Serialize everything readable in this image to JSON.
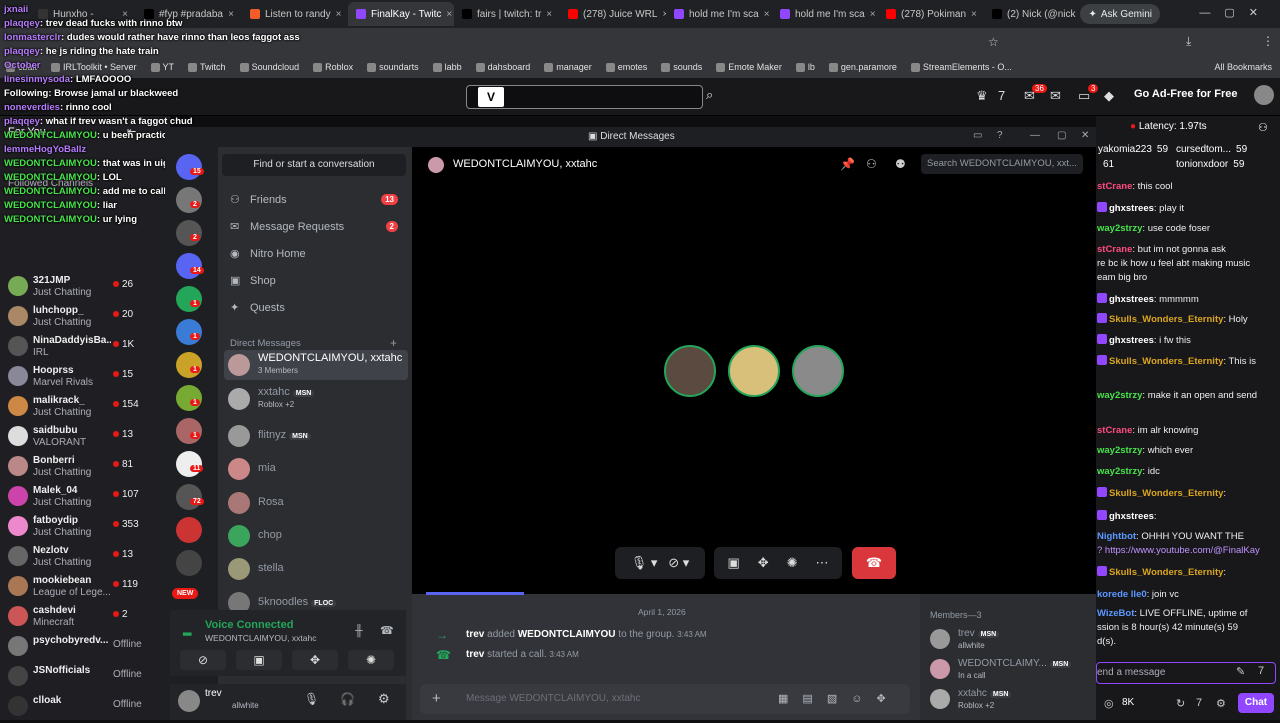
{
  "browser": {
    "tabs": [
      {
        "title": "Hunxho -",
        "color": "#333"
      },
      {
        "title": "#fyp #pradaba",
        "color": "#000"
      },
      {
        "title": "Listen to randy",
        "color": "#f25c29"
      },
      {
        "title": "FinalKay - Twitc",
        "color": "#9147ff",
        "active": true
      },
      {
        "title": "fairs | twitch: tr",
        "color": "#000"
      },
      {
        "title": "(278) Juice WRL",
        "color": "#ff0000"
      },
      {
        "title": "hold me I'm sca",
        "color": "#9147ff"
      },
      {
        "title": "hold me I'm sca",
        "color": "#9147ff"
      },
      {
        "title": "(278) Pokiman",
        "color": "#ff0000"
      },
      {
        "title": "(2) Nick (@nick",
        "color": "#000"
      }
    ],
    "gemini": "Ask Gemini",
    "bookmarks": [
      "cbalt",
      "IRLToolkit • Server",
      "YT",
      "Twitch",
      "Soundcloud",
      "Roblox",
      "soundarts",
      "labb",
      "dahsboard",
      "manager",
      "emotes",
      "sounds",
      "Emote Maker",
      "lb",
      "gen.paramore",
      "StreamElements - O..."
    ],
    "all_bookmarks": "All Bookmarks"
  },
  "twitch": {
    "go_adfree": "Go Ad-Free for Free",
    "latency": "Latency: 1.97ts",
    "badges": {
      "notif": "36",
      "whisper": "3"
    },
    "sidebar": {
      "for_you": "For You",
      "followed_channels": "Followed Channels",
      "channels": [
        {
          "name": "321JMP",
          "game": "Just Chatting",
          "viewers": "26",
          "color": "#7a5"
        },
        {
          "name": "luhchopp_",
          "game": "Just Chatting",
          "viewers": "20",
          "color": "#a86"
        },
        {
          "name": "NinaDaddyisBa...",
          "game": "IRL",
          "viewers": "1K",
          "color": "#555"
        },
        {
          "name": "Hooprss",
          "game": "Marvel Rivals",
          "viewers": "15",
          "color": "#889"
        },
        {
          "name": "malikrack_",
          "game": "Just Chatting",
          "viewers": "154",
          "color": "#c84"
        },
        {
          "name": "saidbubu",
          "game": "VALORANT",
          "viewers": "13",
          "color": "#ddd"
        },
        {
          "name": "Bonberri",
          "game": "Just Chatting",
          "viewers": "81",
          "color": "#b88"
        },
        {
          "name": "Malek_04",
          "game": "Just Chatting",
          "viewers": "107",
          "color": "#c4a"
        },
        {
          "name": "fatboydip",
          "game": "Just Chatting",
          "viewers": "353",
          "color": "#e8c"
        },
        {
          "name": "Nezlotv",
          "game": "Just Chatting",
          "viewers": "13",
          "color": "#666"
        },
        {
          "name": "mookiebean",
          "game": "League of Lege...",
          "viewers": "119",
          "color": "#a75"
        },
        {
          "name": "cashdevi",
          "game": "Minecraft",
          "viewers": "2",
          "color": "#c55"
        },
        {
          "name": "psychobyredv...",
          "game": "",
          "viewers": "Offline",
          "color": "#777"
        },
        {
          "name": "JSNofficials",
          "game": "",
          "viewers": "Offline",
          "color": "#444"
        },
        {
          "name": "clloak",
          "game": "",
          "viewers": "Offline",
          "color": "#333"
        }
      ]
    }
  },
  "overlay_chat": [
    {
      "user": "jxnaii",
      "text": "",
      "color": "#b77cff"
    },
    {
      "user": "plaqqey",
      "text": "trev dead fucks with rinno btw",
      "color": "#b77cff"
    },
    {
      "user": "lonmasterclr",
      "text": "dudes would rather have rinno than leos faggot ass",
      "color": "#b77cff"
    },
    {
      "user": "plaqqey",
      "text": "he js riding the hate train",
      "color": "#b77cff"
    },
    {
      "user": "October",
      "text": "",
      "color": "#b77cff"
    },
    {
      "user": "linesinmysoda",
      "text": "LMFAOOOO",
      "color": "#b77cff"
    },
    {
      "user": "Following",
      "text": "Browse  jamal ur blackweed",
      "color": "#ffffff"
    },
    {
      "user": "noneverdies",
      "text": "rinno cool",
      "color": "#b77cff"
    },
    {
      "user": "plaqqey",
      "text": "what if trev wasn't a faggot chud",
      "color": "#b77cff"
    },
    {
      "user": "WEDONTCLAIMYOU",
      "text": "u been practicing that laugh since xrt huh",
      "color": "#47e34a"
    },
    {
      "user": "IemmeHogYoBallz",
      "text": "",
      "color": "#b77cff"
    },
    {
      "user": "WEDONTCLAIMYOU",
      "text": "that was in uigc tw",
      "color": "#47e34a"
    },
    {
      "user": "WEDONTCLAIMYOU",
      "text": "LOL",
      "color": "#47e34a"
    },
    {
      "user": "WEDONTCLAIMYOU",
      "text": "add me to call",
      "color": "#47e34a"
    },
    {
      "user": "WEDONTCLAIMYOU",
      "text": "liar",
      "color": "#47e34a"
    },
    {
      "user": "WEDONTCLAIMYOU",
      "text": "ur lying",
      "color": "#47e34a"
    }
  ],
  "discord": {
    "window_title": "Direct Messages",
    "find_conversation": "Find or start a conversation",
    "nav": [
      {
        "label": "Friends",
        "badge": "13"
      },
      {
        "label": "Message Requests",
        "badge": "2"
      },
      {
        "label": "Nitro Home",
        "badge": ""
      },
      {
        "label": "Shop",
        "badge": ""
      },
      {
        "label": "Quests",
        "badge": ""
      }
    ],
    "direct_messages_header": "Direct Messages",
    "dms": [
      {
        "name": "WEDONTCLAIMYOU, xxtahc",
        "sub": "3 Members",
        "active": true,
        "color": "#b99"
      },
      {
        "name": "xxtahc",
        "sub": "Roblox +2",
        "badge": "MSN",
        "color": "#aaa"
      },
      {
        "name": "flitnyz",
        "sub": "",
        "badge": "MSN",
        "color": "#999"
      },
      {
        "name": "mia",
        "sub": "",
        "color": "#c88"
      },
      {
        "name": "Rosa",
        "sub": "",
        "color": "#a77"
      },
      {
        "name": "chop",
        "sub": "",
        "color": "#3ba55d"
      },
      {
        "name": "stella",
        "sub": "",
        "color": "#997"
      },
      {
        "name": "5knoodles",
        "sub": "",
        "badge": "FLOC",
        "color": "#777"
      }
    ],
    "voice": {
      "status": "Voice Connected",
      "channel": "WEDONTCLAIMYOU, xxtahc"
    },
    "user": {
      "name": "trev",
      "status": "allwhite"
    },
    "call_header": "WEDONTCLAIMYOU, xxtahc",
    "search_placeholder": "Search WEDONTCLAIMYOU, xxt...",
    "messages": {
      "date": "April 1, 2026",
      "added": {
        "actor": "trev",
        "verb": "added",
        "target": "WEDONTCLAIMYOU",
        "rest": "to the group.",
        "time": "3:43 AM"
      },
      "call": {
        "actor": "trev",
        "text": "started a call.",
        "time": "3:43 AM"
      }
    },
    "message_placeholder": "Message WEDONTCLAIMYOU, xxtahc",
    "members": {
      "header": "Members—3",
      "list": [
        {
          "name": "trev",
          "badge": "MSN",
          "sub": "allwhite",
          "color": "#999"
        },
        {
          "name": "WEDONTCLAIMY...",
          "badge": "MSN",
          "sub": "In a call",
          "color": "#c9a"
        },
        {
          "name": "xxtahc",
          "badge": "MSN",
          "sub": "Roblox +2",
          "color": "#aaa"
        }
      ]
    },
    "new_badge": "NEW",
    "guild_badges": [
      "15",
      "2",
      "2",
      "14",
      "1",
      "1",
      "1",
      "1",
      "1",
      "11",
      "72"
    ]
  },
  "right_chat": {
    "top": [
      {
        "user": "yakomia223",
        "count": "59"
      },
      {
        "user": "cursedtom...",
        "count": "59"
      },
      {
        "user": "",
        "count": "61"
      },
      {
        "user": "tonionxdoor",
        "count": "59"
      }
    ],
    "lines": [
      {
        "user": "stCrane",
        "text": "this cool",
        "ucolor": "#ff4a80"
      },
      {
        "user": "ghxstrees",
        "text": "play it",
        "ucolor": "#ffffff"
      },
      {
        "user": "way2strzy",
        "text": "use code foser",
        "ucolor": "#47e34a"
      },
      {
        "user": "stCrane",
        "text": "but im not gonna ask",
        "ucolor": "#ff4a80"
      },
      {
        "user": "",
        "text": "re bc ik how u feel abt making music",
        "ucolor": "#ffffff"
      },
      {
        "user": "",
        "text": "eam big bro",
        "ucolor": "#ffffff"
      },
      {
        "user": "ghxstrees",
        "text": "mmmmm",
        "ucolor": "#ffffff"
      },
      {
        "user": "Skulls_Wonders_Eternity",
        "text": "Holy",
        "ucolor": "#daa520"
      },
      {
        "user": "ghxstrees",
        "text": "i fw this",
        "ucolor": "#ffffff"
      },
      {
        "user": "Skulls_Wonders_Eternity",
        "text": "This is",
        "ucolor": "#daa520"
      },
      {
        "user": "way2strzy",
        "text": "make it an open and send",
        "ucolor": "#47e34a"
      },
      {
        "user": "",
        "text": "",
        "ucolor": "#ffffff"
      },
      {
        "user": "stCrane",
        "text": "im alr knowing",
        "ucolor": "#ff4a80"
      },
      {
        "user": "way2strzy",
        "text": "which ever",
        "ucolor": "#47e34a"
      },
      {
        "user": "way2strzy",
        "text": "idc",
        "ucolor": "#47e34a"
      },
      {
        "user": "Skulls_Wonders_Eternity",
        "text": "",
        "ucolor": "#daa520"
      },
      {
        "user": "ghxstrees",
        "text": "",
        "ucolor": "#ffffff"
      },
      {
        "user": "Nightbot",
        "text": "OHHH YOU WANT THE",
        "ucolor": "#5b99ff"
      },
      {
        "user": "",
        "text": "? https://www.youtube.com/@FinalKay",
        "ucolor": "#ffffff"
      },
      {
        "user": "Skulls_Wonders_Eternity",
        "text": "",
        "ucolor": "#daa520"
      },
      {
        "user": "korede lle0",
        "text": "join vc",
        "ucolor": "#5b99ff"
      },
      {
        "user": "WizeBot",
        "text": "LIVE OFFLINE, uptime of",
        "ucolor": "#5b99ff"
      },
      {
        "user": "",
        "text": "ssion is 8 hour(s) 42 minute(s) 59",
        "ucolor": "#ffffff"
      },
      {
        "user": "",
        "text": "d(s).",
        "ucolor": "#ffffff"
      }
    ],
    "send_placeholder": "end a message",
    "points": "8K",
    "chat_button": "Chat"
  }
}
